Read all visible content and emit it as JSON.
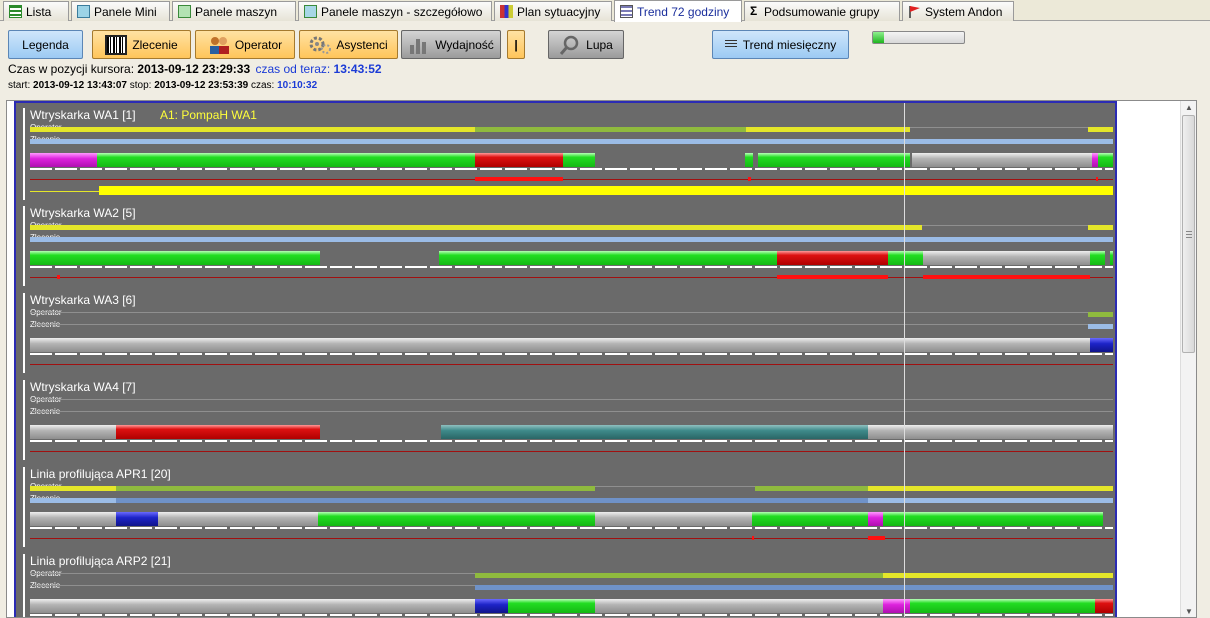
{
  "tabs": [
    {
      "label": "Lista",
      "icon": "list-icon",
      "active": false
    },
    {
      "label": "Panele Mini",
      "icon": "grid-icon",
      "active": false
    },
    {
      "label": "Panele maszyn",
      "icon": "panel-icon",
      "active": false
    },
    {
      "label": "Panele maszyn - szczegółowo",
      "icon": "panel-detail-icon",
      "active": false
    },
    {
      "label": "Plan sytuacyjny",
      "icon": "map-icon",
      "active": false
    },
    {
      "label": "Trend 72 godziny",
      "icon": "trend-icon",
      "active": true
    },
    {
      "label": "Podsumowanie grupy",
      "icon": "sigma-icon",
      "active": false
    },
    {
      "label": "System Andon",
      "icon": "flag-icon",
      "active": false
    }
  ],
  "toolbar": {
    "legend": "Legenda",
    "order": "Zlecenie",
    "operator": "Operator",
    "assistants": "Asystenci",
    "efficiency": "Wydajność",
    "separator": "|",
    "zoom": "Lupa",
    "monthly_trend": "Trend miesięczny",
    "progress": 0.12
  },
  "cursor_info": {
    "label": "Czas w pozycji kursora:",
    "time": "2013-09-12 23:29:33",
    "since_label": "czas od teraz:",
    "since": "13:43:52"
  },
  "range_info": {
    "start_label": "start:",
    "start": "2013-09-12 13:43:07",
    "stop_label": "stop:",
    "stop": "2013-09-12 23:53:39",
    "duration_label": "czas:",
    "duration": "10:10:32"
  },
  "labels": {
    "operator": "Operator",
    "order": "Zlecenie"
  },
  "machines": [
    {
      "name": "Wtryskarka WA1 [1]",
      "assistant": "A1: PompaH WA1"
    },
    {
      "name": "Wtryskarka WA2 [5]",
      "assistant": ""
    },
    {
      "name": "Wtryskarka WA3 [6]",
      "assistant": ""
    },
    {
      "name": "Wtryskarka WA4 [7]",
      "assistant": ""
    },
    {
      "name": "Linia profilująca APR1 [20]",
      "assistant": ""
    },
    {
      "name": "Linia profilująca ARP2 [21]",
      "assistant": ""
    }
  ],
  "colors": {
    "running": "#22dd22",
    "stopped": "#dd1111",
    "idle": "#b4b4b4",
    "setup": "#dd22dd",
    "maintenance": "#1d24c8",
    "other": "#3e8a8a",
    "operator_line": "#e4e62a",
    "order_line": "#9bbce6",
    "accent": "#2b2bb4"
  }
}
